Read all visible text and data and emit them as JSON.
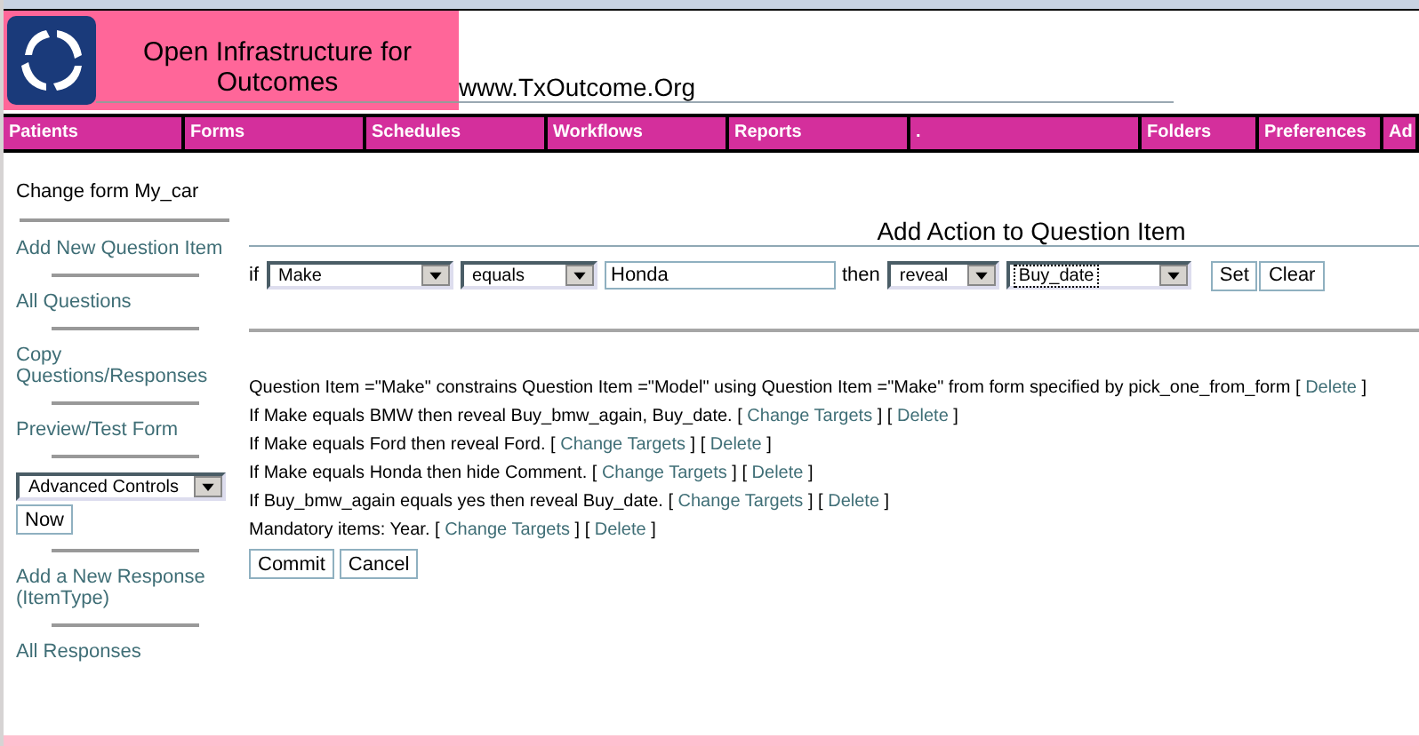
{
  "header": {
    "title": "Open Infrastructure for Outcomes",
    "url": "www.TxOutcome.Org"
  },
  "nav": [
    {
      "label": "Patients"
    },
    {
      "label": "Forms"
    },
    {
      "label": "Schedules"
    },
    {
      "label": "Workflows"
    },
    {
      "label": "Reports"
    },
    {
      "label": "."
    },
    {
      "label": "Folders"
    },
    {
      "label": "Preferences"
    },
    {
      "label": "Ad"
    }
  ],
  "sidebar": {
    "items": [
      {
        "kind": "heading",
        "label": "Change form My_car"
      },
      {
        "kind": "link",
        "label": "Add New Question Item"
      },
      {
        "kind": "link",
        "label": "All Questions"
      },
      {
        "kind": "link",
        "label": "Copy Questions/Responses"
      },
      {
        "kind": "link",
        "label": "Preview/Test Form"
      },
      {
        "kind": "select",
        "value": "Advanced Controls",
        "button": "Now"
      },
      {
        "kind": "link",
        "label": "Add a New Response (ItemType)"
      },
      {
        "kind": "link",
        "label": "All Responses"
      }
    ]
  },
  "action": {
    "title": "Add Action to Question Item",
    "if_label": "if",
    "question": "Make",
    "operator": "equals",
    "value": "Honda",
    "then_label": "then",
    "action": "reveal",
    "target": "Buy_date",
    "buttons": [
      "Set",
      "Clear"
    ]
  },
  "rules": [
    [
      {
        "kind": "text",
        "text": "Question Item =\"Make\" constrains Question Item =\"Model\" using Question Item =\"Make\" from form specified by pick_one_from_form ["
      },
      {
        "kind": "link",
        "text": "Delete"
      },
      {
        "kind": "text",
        "text": "]"
      }
    ],
    [
      {
        "kind": "text",
        "text": "If Make equals BMW then reveal Buy_bmw_again, Buy_date. ["
      },
      {
        "kind": "link",
        "text": "Change Targets"
      },
      {
        "kind": "text",
        "text": "] ["
      },
      {
        "kind": "link",
        "text": "Delete"
      },
      {
        "kind": "text",
        "text": "]"
      }
    ],
    [
      {
        "kind": "text",
        "text": "If Make equals Ford then reveal Ford. ["
      },
      {
        "kind": "link",
        "text": "Change Targets"
      },
      {
        "kind": "text",
        "text": "] ["
      },
      {
        "kind": "link",
        "text": "Delete"
      },
      {
        "kind": "text",
        "text": "]"
      }
    ],
    [
      {
        "kind": "text",
        "text": "If Make equals Honda then hide Comment. ["
      },
      {
        "kind": "link",
        "text": "Change Targets"
      },
      {
        "kind": "text",
        "text": "] ["
      },
      {
        "kind": "link",
        "text": "Delete"
      },
      {
        "kind": "text",
        "text": "]"
      }
    ],
    [
      {
        "kind": "text",
        "text": "If Buy_bmw_again equals yes then reveal Buy_date. ["
      },
      {
        "kind": "link",
        "text": "Change Targets"
      },
      {
        "kind": "text",
        "text": "] ["
      },
      {
        "kind": "link",
        "text": "Delete"
      },
      {
        "kind": "text",
        "text": "]"
      }
    ],
    [
      {
        "kind": "text",
        "text": "Mandatory items: Year. ["
      },
      {
        "kind": "link",
        "text": "Change Targets"
      },
      {
        "kind": "text",
        "text": "] ["
      },
      {
        "kind": "link",
        "text": "Delete"
      },
      {
        "kind": "text",
        "text": "]"
      }
    ]
  ],
  "footer_buttons": [
    "Commit",
    "Cancel"
  ]
}
